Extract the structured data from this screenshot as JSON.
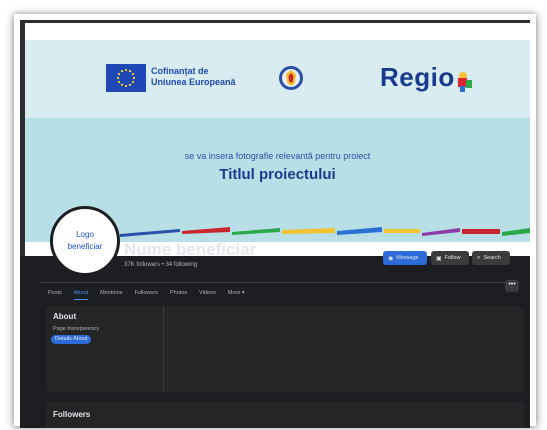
{
  "cover": {
    "eu_text_line1": "Cofinanțat de",
    "eu_text_line2": "Uniunea Europeană",
    "regio_text": "Regio",
    "caption": "se va insera fotografie relevantă pentru proiect",
    "title": "Titlul proiectului"
  },
  "profile": {
    "avatar_line1": "Logo",
    "avatar_line2": "beneficiar",
    "name": "Nume beneficiar",
    "stats": "37K followers • 34 following"
  },
  "actions": {
    "message": "Message",
    "follow": "Follow",
    "search": "Search"
  },
  "tabs": [
    "Posts",
    "About",
    "Mentions",
    "Followers",
    "Photos",
    "Videos",
    "More ▾"
  ],
  "more_menu": "•••",
  "about": {
    "title": "About",
    "page_transparency": "Page transparency",
    "details": "Details About"
  },
  "followers": {
    "title": "Followers"
  },
  "colors": {
    "accent": "#2d6bd9",
    "background": "#1c1e21",
    "card": "#242526",
    "eu_blue": "#1f47b5",
    "regio_blue": "#1b3a8e"
  }
}
